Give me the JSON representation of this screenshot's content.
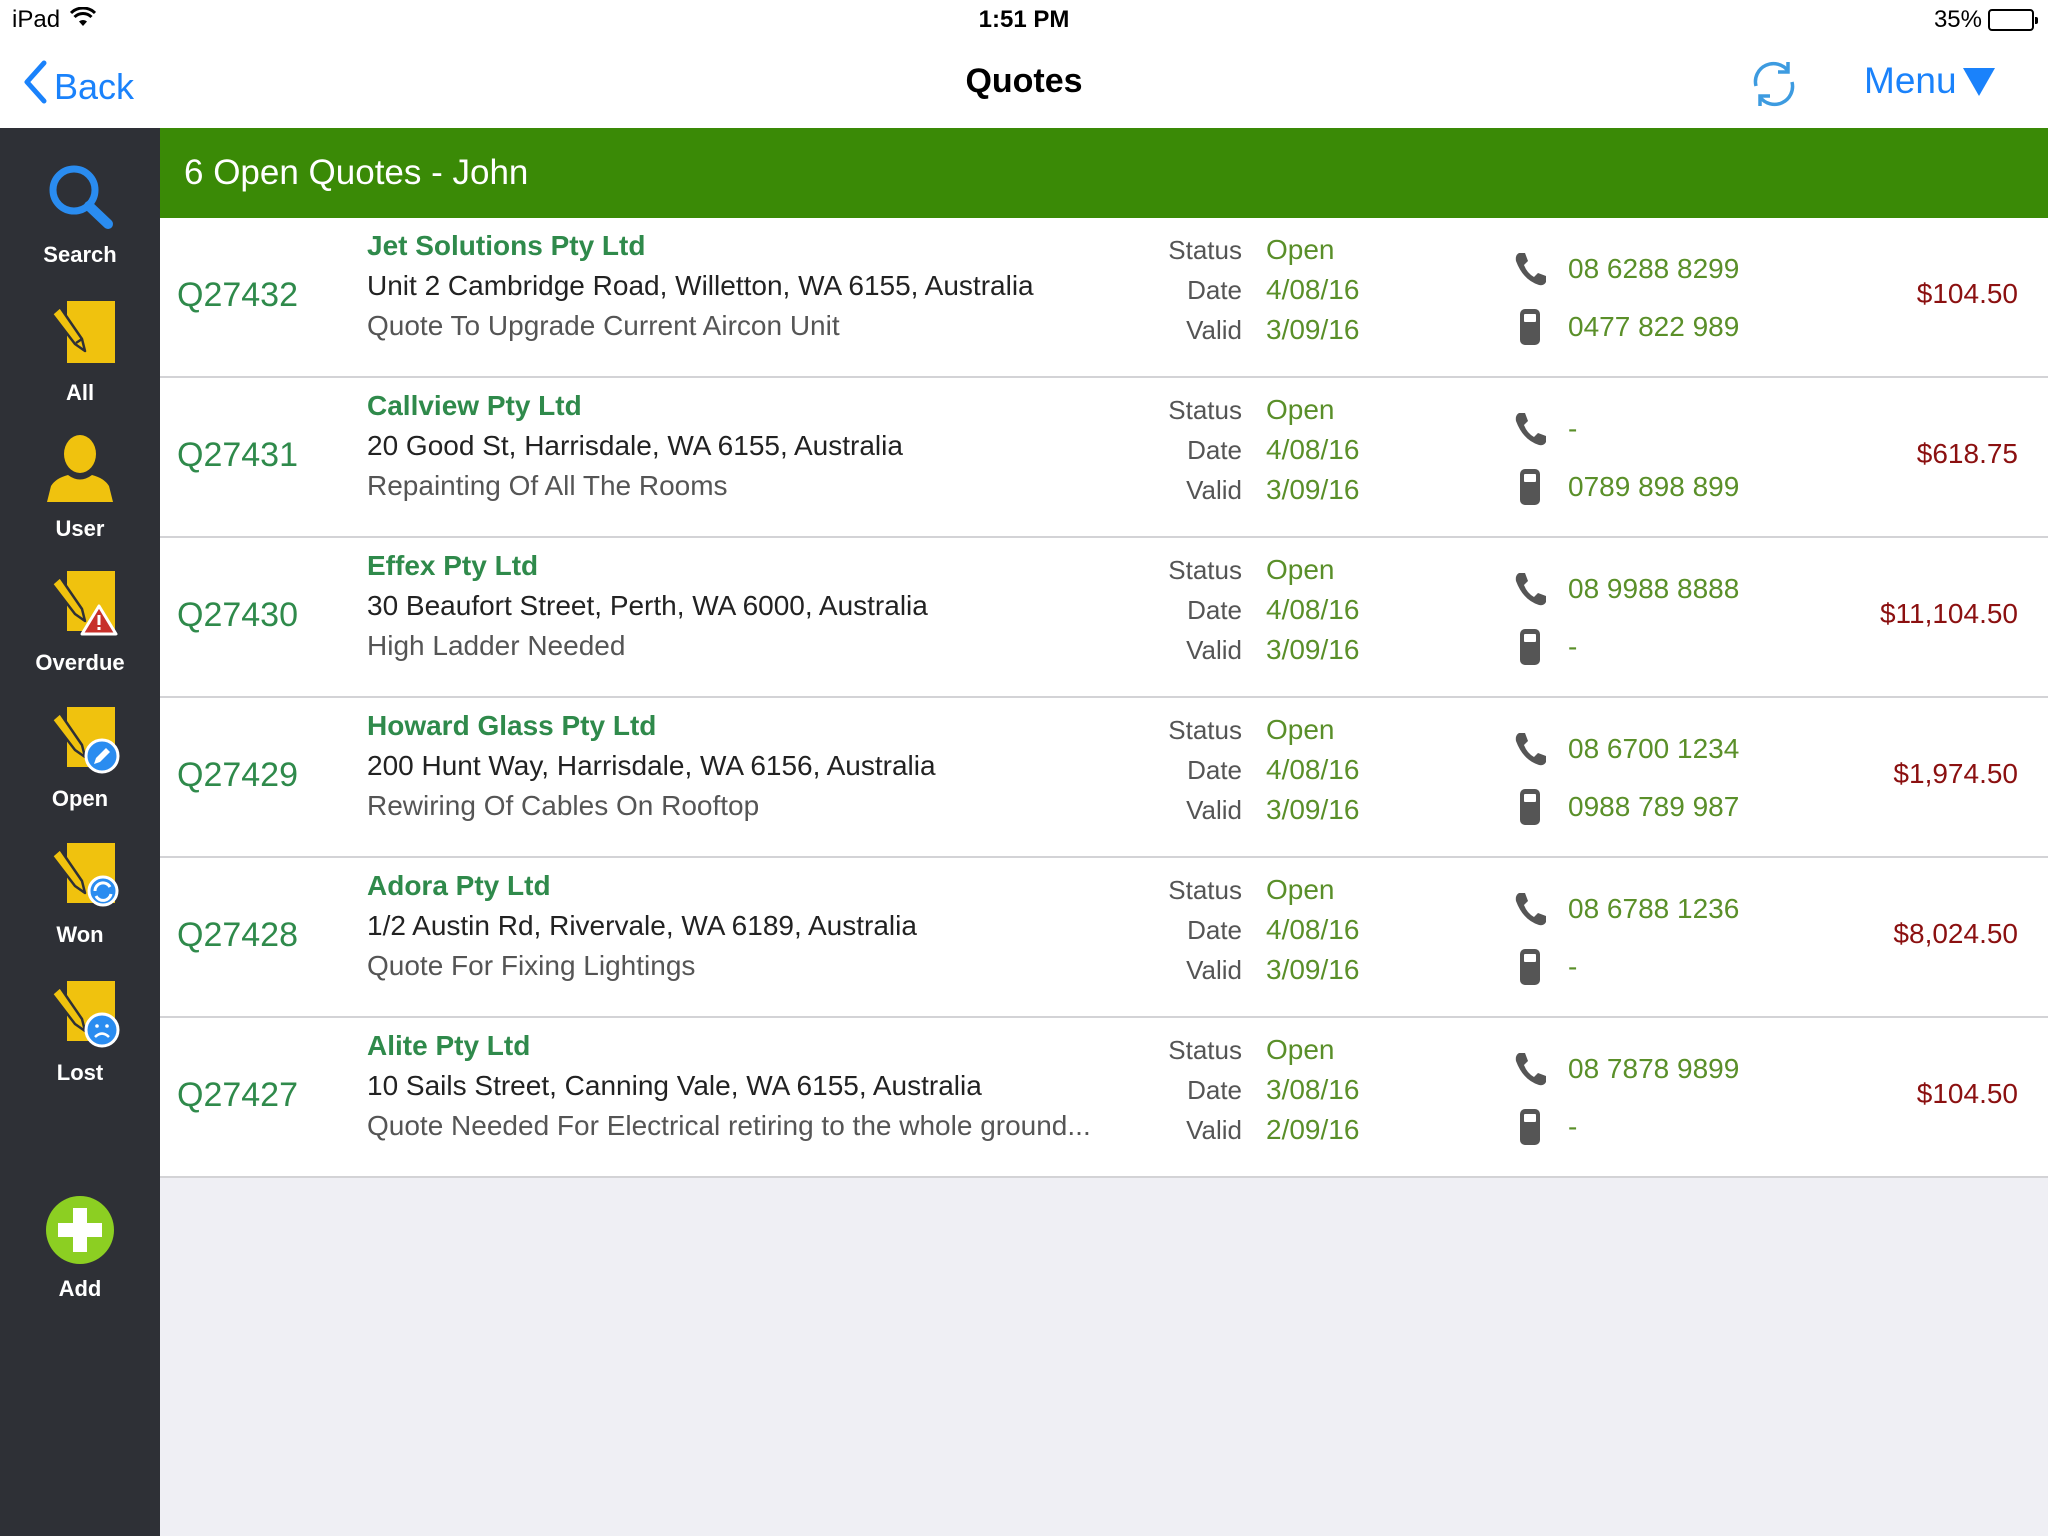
{
  "status_bar": {
    "device": "iPad",
    "time": "1:51 PM",
    "battery_percent_label": "35%",
    "battery_level": 0.35
  },
  "nav": {
    "back_label": "Back",
    "title": "Quotes",
    "refresh_icon": "refresh-icon",
    "menu_label": "Menu"
  },
  "sidebar": {
    "items": [
      {
        "label": "Search",
        "icon": "search-icon"
      },
      {
        "label": "All",
        "icon": "quote-icon"
      },
      {
        "label": "User",
        "icon": "user-icon"
      },
      {
        "label": "Overdue",
        "icon": "quote-overdue-icon"
      },
      {
        "label": "Open",
        "icon": "quote-open-icon"
      },
      {
        "label": "Won",
        "icon": "quote-won-icon"
      },
      {
        "label": "Lost",
        "icon": "quote-lost-icon"
      },
      {
        "label": "Add",
        "icon": "add-icon"
      }
    ]
  },
  "list": {
    "header": "6 Open Quotes - John",
    "labels": {
      "status": "Status",
      "date": "Date",
      "valid": "Valid"
    },
    "quotes": [
      {
        "id": "Q27432",
        "company": "Jet Solutions Pty Ltd",
        "address": "Unit 2 Cambridge Road, Willetton, WA 6155, Australia",
        "description": "Quote To Upgrade Current Aircon Unit",
        "status": "Open",
        "date": "4/08/16",
        "valid": "3/09/16",
        "phone": "08 6288 8299",
        "mobile": "0477 822 989",
        "amount": "$104.50"
      },
      {
        "id": "Q27431",
        "company": "Callview Pty Ltd",
        "address": "20 Good St, Harrisdale, WA 6155, Australia",
        "description": "Repainting Of All The Rooms",
        "status": "Open",
        "date": "4/08/16",
        "valid": "3/09/16",
        "phone": "-",
        "mobile": "0789 898 899",
        "amount": "$618.75"
      },
      {
        "id": "Q27430",
        "company": "Effex Pty Ltd",
        "address": "30 Beaufort Street, Perth, WA 6000, Australia",
        "description": "High Ladder Needed",
        "status": "Open",
        "date": "4/08/16",
        "valid": "3/09/16",
        "phone": "08 9988 8888",
        "mobile": "-",
        "amount": "$11,104.50"
      },
      {
        "id": "Q27429",
        "company": "Howard Glass Pty Ltd",
        "address": "200 Hunt Way, Harrisdale, WA 6156, Australia",
        "description": "Rewiring Of Cables On Rooftop",
        "status": "Open",
        "date": "4/08/16",
        "valid": "3/09/16",
        "phone": "08 6700 1234",
        "mobile": "0988 789 987",
        "amount": "$1,974.50"
      },
      {
        "id": "Q27428",
        "company": "Adora Pty Ltd",
        "address": "1/2 Austin Rd, Rivervale, WA 6189, Australia",
        "description": "Quote For Fixing Lightings",
        "status": "Open",
        "date": "4/08/16",
        "valid": "3/09/16",
        "phone": "08 6788 1236",
        "mobile": "-",
        "amount": "$8,024.50"
      },
      {
        "id": "Q27427",
        "company": "Alite Pty Ltd",
        "address": "10 Sails Street, Canning Vale, WA 6155, Australia",
        "description": "Quote Needed For Electrical retiring to the whole ground...",
        "status": "Open",
        "date": "3/08/16",
        "valid": "2/09/16",
        "phone": "08 7878 9899",
        "mobile": "-",
        "amount": "$104.50"
      }
    ]
  },
  "colors": {
    "accent_blue": "#1a82fb",
    "header_green": "#3a8a06",
    "text_green": "#2f8a4b",
    "value_green": "#5a8f29",
    "amount_red": "#8b1010",
    "sidebar_bg": "#2e3036",
    "icon_yellow": "#f0c20e"
  }
}
